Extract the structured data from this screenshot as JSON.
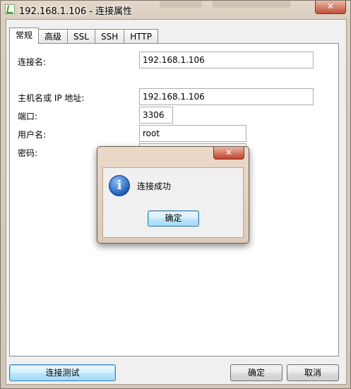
{
  "window": {
    "title": "192.168.1.106 - 连接属性",
    "close_glyph": "✕"
  },
  "tabs": [
    {
      "label": "常规",
      "active": true
    },
    {
      "label": "高级",
      "active": false
    },
    {
      "label": "SSL",
      "active": false
    },
    {
      "label": "SSH",
      "active": false
    },
    {
      "label": "HTTP",
      "active": false
    }
  ],
  "form": {
    "connection_name_label": "连接名:",
    "connection_name_value": "192.168.1.106",
    "host_label": "主机名或 IP 地址:",
    "host_value": "192.168.1.106",
    "port_label": "端口:",
    "port_value": "3306",
    "username_label": "用户名:",
    "username_value": "root",
    "password_label": "密码:"
  },
  "buttons": {
    "test_connection": "连接测试",
    "ok": "确定",
    "cancel": "取消"
  },
  "dialog": {
    "message": "连接成功",
    "ok": "确定",
    "icon": "info-icon",
    "close_glyph": "✕"
  }
}
